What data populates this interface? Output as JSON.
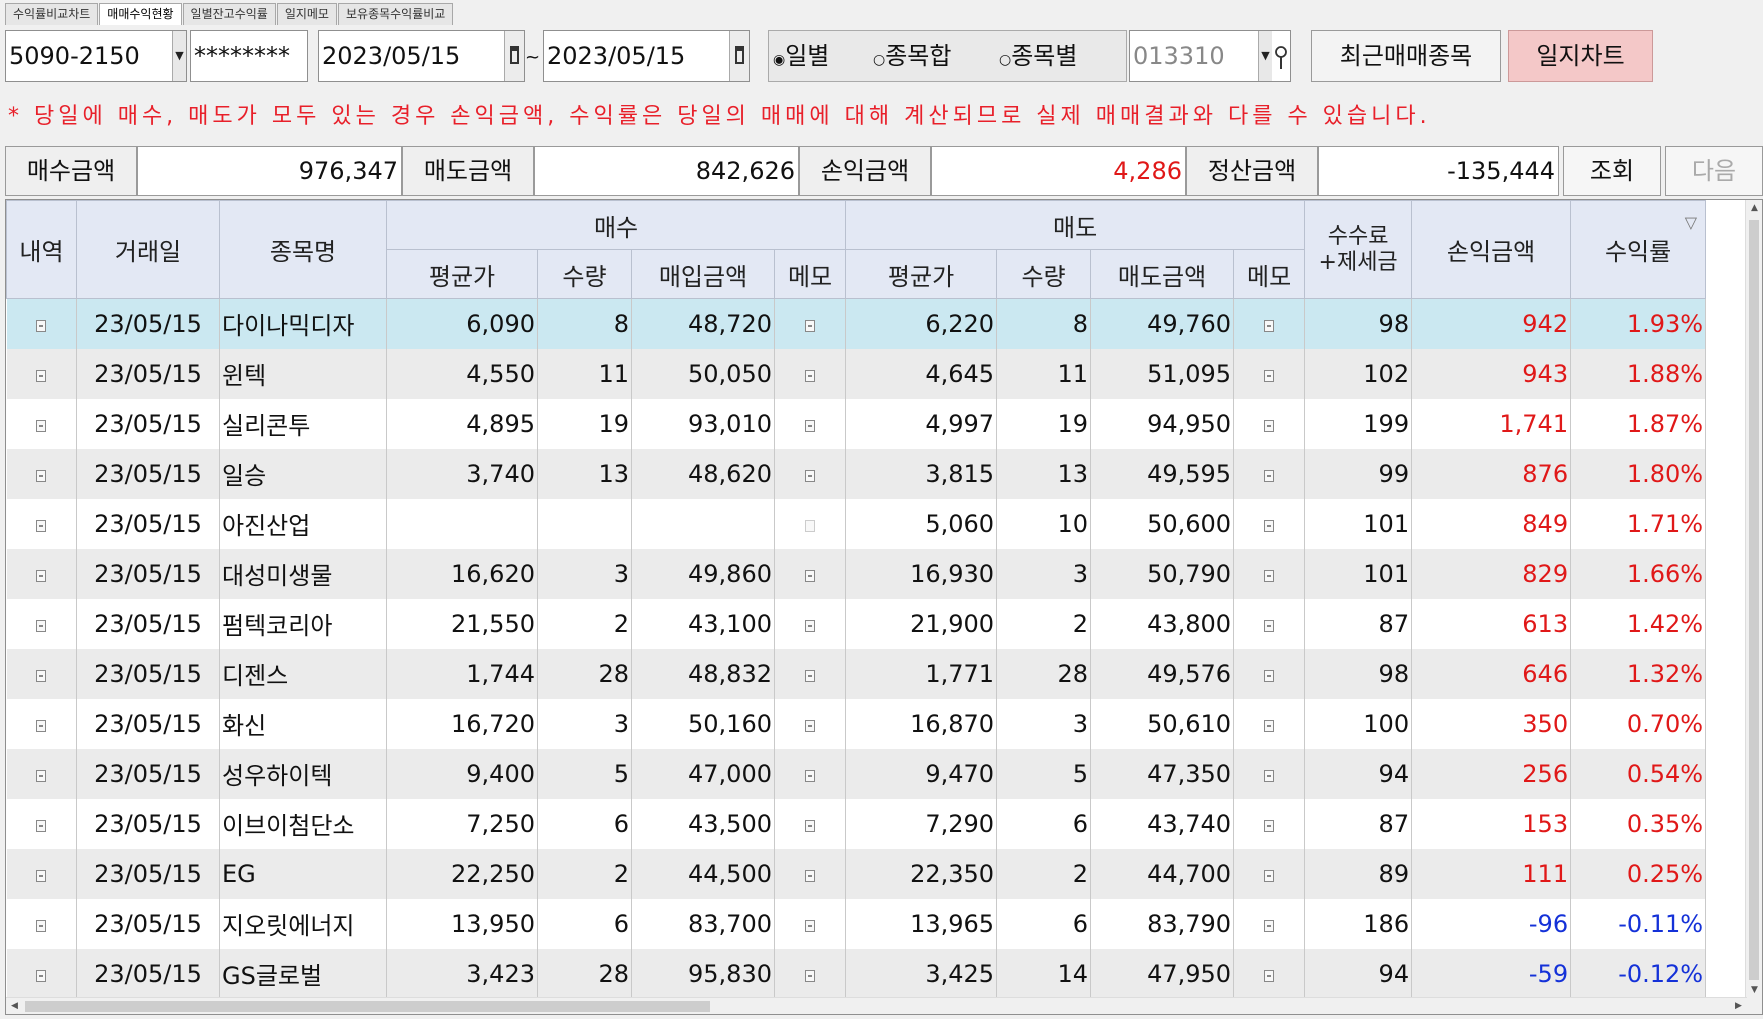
{
  "tabs": [
    "수익률비교차트",
    "매매수익현황",
    "일별잔고수익률",
    "일지메모",
    "보유종목수익률비교"
  ],
  "active_tab": 1,
  "toolbar": {
    "account": "5090-2150",
    "password": "********",
    "date_from": "2023/05/15",
    "date_to": "2023/05/15",
    "tilde": "~",
    "radio_daily": "일별",
    "radio_stock_sum": "종목합",
    "radio_by_stock": "종목별",
    "stock_code": "013310",
    "recent_button": "최근매매종목",
    "chart_button": "일지차트"
  },
  "notice": "* 당일에 매수, 매도가 모두 있는 경우 손익금액, 수익률은 당일의 매매에 대해 계산되므로 실제 매매결과와 다를 수 있습니다.",
  "summary": {
    "buy_label": "매수금액",
    "buy_value": "976,347",
    "sell_label": "매도금액",
    "sell_value": "842,626",
    "pnl_label": "손익금액",
    "pnl_value": "4,286",
    "settle_label": "정산금액",
    "settle_value": "-135,444",
    "query_button": "조회",
    "next_button": "다음"
  },
  "colors": {
    "profit": "#e01818",
    "loss": "#1431d8",
    "selected_row": "#cbe8f1",
    "header_bg": "#e3e8f4",
    "pink_button": "#f4c8c8"
  },
  "table": {
    "headers": {
      "detail": "내역",
      "date": "거래일",
      "name": "종목명",
      "buy_group": "매수",
      "sell_group": "매도",
      "buy_avg": "평균가",
      "buy_qty": "수량",
      "buy_amount": "매입금액",
      "buy_memo": "메모",
      "sell_avg": "평균가",
      "sell_qty": "수량",
      "sell_amount": "매도금액",
      "sell_memo": "메모",
      "fee_line1": "수수료",
      "fee_line2": "+제세금",
      "pnl": "손익금액",
      "rate": "수익률"
    },
    "rows": [
      {
        "date": "23/05/15",
        "name": "다이나믹디자",
        "buy_avg": "6,090",
        "buy_qty": "8",
        "buy_amount": "48,720",
        "sell_avg": "6,220",
        "sell_qty": "8",
        "sell_amount": "49,760",
        "fee": "98",
        "pnl": "942",
        "rate": "1.93%",
        "sign": "pos",
        "buy_memo": true
      },
      {
        "date": "23/05/15",
        "name": "윈텍",
        "buy_avg": "4,550",
        "buy_qty": "11",
        "buy_amount": "50,050",
        "sell_avg": "4,645",
        "sell_qty": "11",
        "sell_amount": "51,095",
        "fee": "102",
        "pnl": "943",
        "rate": "1.88%",
        "sign": "pos",
        "buy_memo": true
      },
      {
        "date": "23/05/15",
        "name": "실리콘투",
        "buy_avg": "4,895",
        "buy_qty": "19",
        "buy_amount": "93,010",
        "sell_avg": "4,997",
        "sell_qty": "19",
        "sell_amount": "94,950",
        "fee": "199",
        "pnl": "1,741",
        "rate": "1.87%",
        "sign": "pos",
        "buy_memo": true
      },
      {
        "date": "23/05/15",
        "name": "일승",
        "buy_avg": "3,740",
        "buy_qty": "13",
        "buy_amount": "48,620",
        "sell_avg": "3,815",
        "sell_qty": "13",
        "sell_amount": "49,595",
        "fee": "99",
        "pnl": "876",
        "rate": "1.80%",
        "sign": "pos",
        "buy_memo": true
      },
      {
        "date": "23/05/15",
        "name": "아진산업",
        "buy_avg": "",
        "buy_qty": "",
        "buy_amount": "",
        "sell_avg": "5,060",
        "sell_qty": "10",
        "sell_amount": "50,600",
        "fee": "101",
        "pnl": "849",
        "rate": "1.71%",
        "sign": "pos",
        "buy_memo": false
      },
      {
        "date": "23/05/15",
        "name": "대성미생물",
        "buy_avg": "16,620",
        "buy_qty": "3",
        "buy_amount": "49,860",
        "sell_avg": "16,930",
        "sell_qty": "3",
        "sell_amount": "50,790",
        "fee": "101",
        "pnl": "829",
        "rate": "1.66%",
        "sign": "pos",
        "buy_memo": true
      },
      {
        "date": "23/05/15",
        "name": "펌텍코리아",
        "buy_avg": "21,550",
        "buy_qty": "2",
        "buy_amount": "43,100",
        "sell_avg": "21,900",
        "sell_qty": "2",
        "sell_amount": "43,800",
        "fee": "87",
        "pnl": "613",
        "rate": "1.42%",
        "sign": "pos",
        "buy_memo": true
      },
      {
        "date": "23/05/15",
        "name": "디젠스",
        "buy_avg": "1,744",
        "buy_qty": "28",
        "buy_amount": "48,832",
        "sell_avg": "1,771",
        "sell_qty": "28",
        "sell_amount": "49,576",
        "fee": "98",
        "pnl": "646",
        "rate": "1.32%",
        "sign": "pos",
        "buy_memo": true
      },
      {
        "date": "23/05/15",
        "name": "화신",
        "buy_avg": "16,720",
        "buy_qty": "3",
        "buy_amount": "50,160",
        "sell_avg": "16,870",
        "sell_qty": "3",
        "sell_amount": "50,610",
        "fee": "100",
        "pnl": "350",
        "rate": "0.70%",
        "sign": "pos",
        "buy_memo": true
      },
      {
        "date": "23/05/15",
        "name": "성우하이텍",
        "buy_avg": "9,400",
        "buy_qty": "5",
        "buy_amount": "47,000",
        "sell_avg": "9,470",
        "sell_qty": "5",
        "sell_amount": "47,350",
        "fee": "94",
        "pnl": "256",
        "rate": "0.54%",
        "sign": "pos",
        "buy_memo": true
      },
      {
        "date": "23/05/15",
        "name": "이브이첨단소",
        "buy_avg": "7,250",
        "buy_qty": "6",
        "buy_amount": "43,500",
        "sell_avg": "7,290",
        "sell_qty": "6",
        "sell_amount": "43,740",
        "fee": "87",
        "pnl": "153",
        "rate": "0.35%",
        "sign": "pos",
        "buy_memo": true
      },
      {
        "date": "23/05/15",
        "name": "EG",
        "buy_avg": "22,250",
        "buy_qty": "2",
        "buy_amount": "44,500",
        "sell_avg": "22,350",
        "sell_qty": "2",
        "sell_amount": "44,700",
        "fee": "89",
        "pnl": "111",
        "rate": "0.25%",
        "sign": "pos",
        "buy_memo": true
      },
      {
        "date": "23/05/15",
        "name": "지오릿에너지",
        "buy_avg": "13,950",
        "buy_qty": "6",
        "buy_amount": "83,700",
        "sell_avg": "13,965",
        "sell_qty": "6",
        "sell_amount": "83,790",
        "fee": "186",
        "pnl": "-96",
        "rate": "-0.11%",
        "sign": "neg",
        "buy_memo": true
      },
      {
        "date": "23/05/15",
        "name": "GS글로벌",
        "buy_avg": "3,423",
        "buy_qty": "28",
        "buy_amount": "95,830",
        "sell_avg": "3,425",
        "sell_qty": "14",
        "sell_amount": "47,950",
        "fee": "94",
        "pnl": "-59",
        "rate": "-0.12%",
        "sign": "neg",
        "buy_memo": true
      }
    ]
  }
}
